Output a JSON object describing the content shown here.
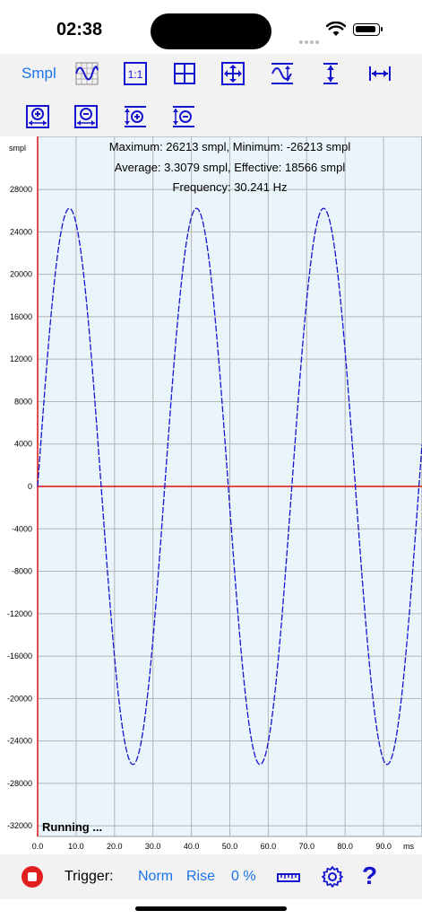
{
  "status": {
    "time": "02:38"
  },
  "toolbar": {
    "units_label": "Smpl",
    "buttons": [
      "waveform-grid",
      "scale-1-1",
      "grid",
      "move",
      "auto-fit",
      "vertical-stretch",
      "horizontal-stretch",
      "zoom-in-x",
      "zoom-out-x",
      "zoom-in-y",
      "zoom-out-y"
    ]
  },
  "measurements": {
    "line1": "Maximum: 26213 smpl, Minimum: -26213 smpl",
    "line2": "Average: 3.3079 smpl, Effective: 18566 smpl",
    "line3": "Frequency: 30.241 Hz"
  },
  "status_text": "Running ...",
  "colors": {
    "accent": "#1a73e8",
    "trace": "#1515d0",
    "zero_line": "#e01010",
    "stop": "#e02020"
  },
  "chart_data": {
    "type": "line",
    "ylabel": "smpl",
    "xlabel": "ms",
    "xlim": [
      0,
      100
    ],
    "ylim": [
      -33000,
      33000
    ],
    "y_ticks": [
      28000,
      24000,
      20000,
      16000,
      12000,
      8000,
      4000,
      0,
      -4000,
      -8000,
      -12000,
      -16000,
      -20000,
      -24000,
      -28000,
      -32000
    ],
    "y_tick_labels": [
      "28000",
      "24000",
      "20000",
      "16000",
      "12000",
      "8000",
      "4000",
      "0",
      "-4000",
      "-8000",
      "-12000",
      "-16000",
      "-20000",
      "-24000",
      "-28000",
      "-32000"
    ],
    "x_ticks": [
      0,
      10,
      20,
      30,
      40,
      50,
      60,
      70,
      80,
      90
    ],
    "x_tick_labels": [
      "0.0",
      "10.0",
      "20.0",
      "30.0",
      "40.0",
      "50.0",
      "60.0",
      "70.0",
      "80.0",
      "90.0"
    ],
    "grid": true,
    "series": [
      {
        "amplitude": 26213,
        "frequency_hz": 30.241,
        "phase": 0
      }
    ]
  },
  "bottom": {
    "trigger_label": "Trigger:",
    "mode": "Norm",
    "edge": "Rise",
    "level": "0 %"
  }
}
